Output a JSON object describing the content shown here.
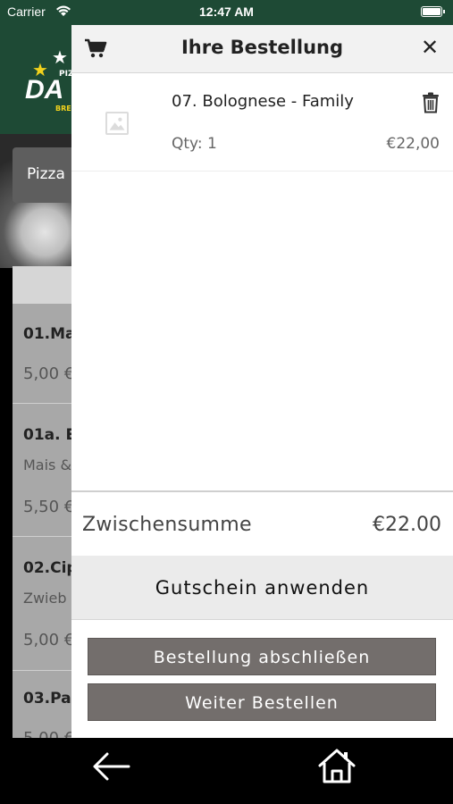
{
  "status_bar": {
    "carrier": "Carrier",
    "time": "12:47 AM"
  },
  "background": {
    "logo": {
      "main": "DA",
      "top": "PIZ",
      "bottom": "BRE"
    },
    "category_pill": "Pizza",
    "menu_items": [
      {
        "title": "01.Ma",
        "subtitle": "",
        "price": "5,00 €"
      },
      {
        "title": "01a. E",
        "subtitle": "Mais &",
        "price": "5,50 €"
      },
      {
        "title": "02.Cip",
        "subtitle": "Zwieb",
        "price": "5,00 €"
      },
      {
        "title": "03.Pa",
        "subtitle": "",
        "price": "5,00 €"
      }
    ]
  },
  "cart": {
    "title": "Ihre Bestellung",
    "close_symbol": "✕",
    "items": [
      {
        "name": "07. Bolognese - Family",
        "qty": "Qty: 1",
        "price": "€22,00"
      }
    ],
    "subtotal_label": "Zwischensumme",
    "subtotal_value": "€22.00",
    "voucher_label": "Gutschein anwenden",
    "checkout_label": "Bestellung abschließen",
    "continue_label": "Weiter Bestellen"
  },
  "icons": {
    "cart": "shopping-cart-icon",
    "close": "close-icon",
    "trash": "trash-icon",
    "image_placeholder": "image-placeholder-icon",
    "back": "back-arrow-icon",
    "home": "home-icon"
  },
  "colors": {
    "header_green": "#1e4a35",
    "button_gray": "#736e6c",
    "voucher_bg": "#ebebeb"
  }
}
